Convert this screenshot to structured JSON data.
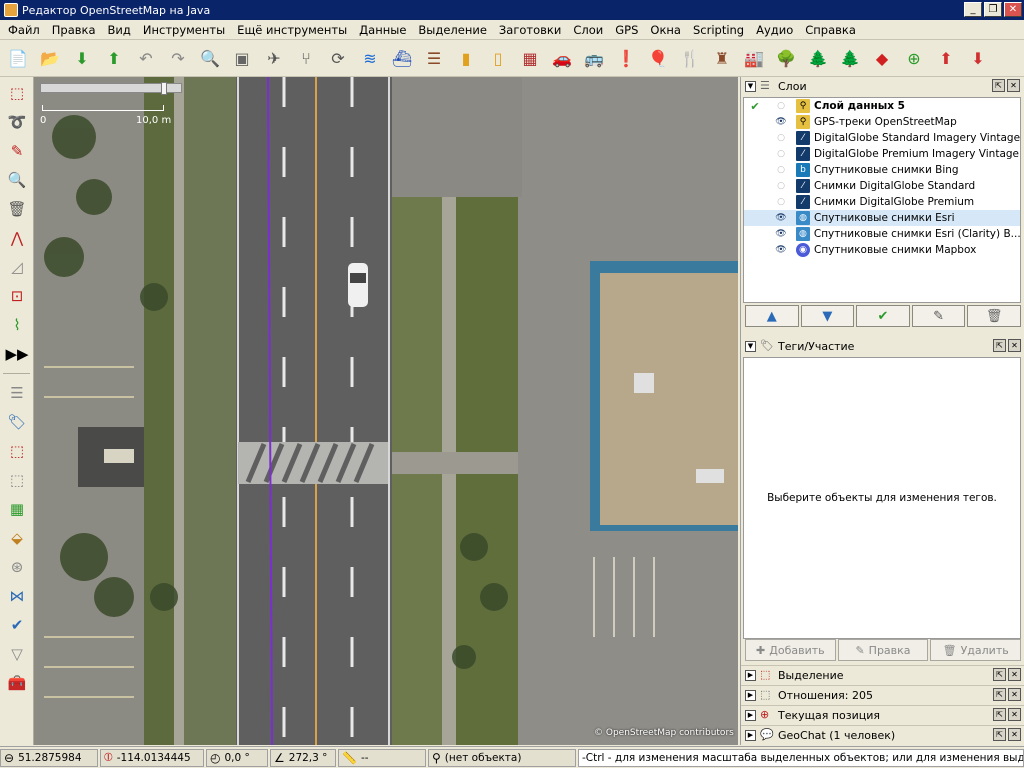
{
  "window": {
    "title": "Редактор OpenStreetMap на Java"
  },
  "menu": [
    "Файл",
    "Правка",
    "Вид",
    "Инструменты",
    "Ещё инструменты",
    "Данные",
    "Выделение",
    "Заготовки",
    "Слои",
    "GPS",
    "Окна",
    "Scripting",
    "Аудио",
    "Справка"
  ],
  "map": {
    "scale_start": "0",
    "scale_end": "10,0 m",
    "attribution": "© OpenStreetMap contributors"
  },
  "layers_panel": {
    "title": "Слои",
    "items": [
      {
        "name": "Слой данных 5",
        "bold": true,
        "active": true,
        "visible": false
      },
      {
        "name": "GPS-треки OpenStreetMap",
        "visible": true
      },
      {
        "name": "DigitalGlobe Standard Imagery Vintage",
        "visible": false
      },
      {
        "name": "DigitalGlobe Premium Imagery Vintage",
        "visible": false
      },
      {
        "name": "Спутниковые снимки Bing",
        "visible": false
      },
      {
        "name": "Снимки DigitalGlobe Standard",
        "visible": false
      },
      {
        "name": "Снимки DigitalGlobe Premium",
        "visible": false
      },
      {
        "name": "Спутниковые снимки Esri",
        "visible": true,
        "selected": true
      },
      {
        "name": "Спутниковые снимки Esri (Clarity) B...",
        "visible": true
      },
      {
        "name": "Спутниковые снимки Mapbox",
        "visible": true
      }
    ]
  },
  "tags_panel": {
    "title": "Теги/Участие",
    "empty_message": "Выберите объекты для изменения тегов.",
    "add_label": "Добавить",
    "edit_label": "Правка",
    "delete_label": "Удалить"
  },
  "collapsed_panels": [
    {
      "title": "Выделение"
    },
    {
      "title": "Отношения: 205"
    },
    {
      "title": "Текущая позиция"
    },
    {
      "title": "GeoChat (1 человек)"
    }
  ],
  "status": {
    "latitude": "51.2875984",
    "longitude": "-114.0134445",
    "heading": "0,0 °",
    "angle": "272,3 °",
    "distance": "--",
    "object": "(нет объекта)",
    "hint": "-Ctrl - для изменения масштаба выделенных объектов; или для изменения выделения"
  },
  "colors": {
    "title_bar": "#0a246a",
    "chrome": "#ece9d8",
    "gps_track": "#7b2fd0",
    "selection_row": "#d6e8f8"
  }
}
